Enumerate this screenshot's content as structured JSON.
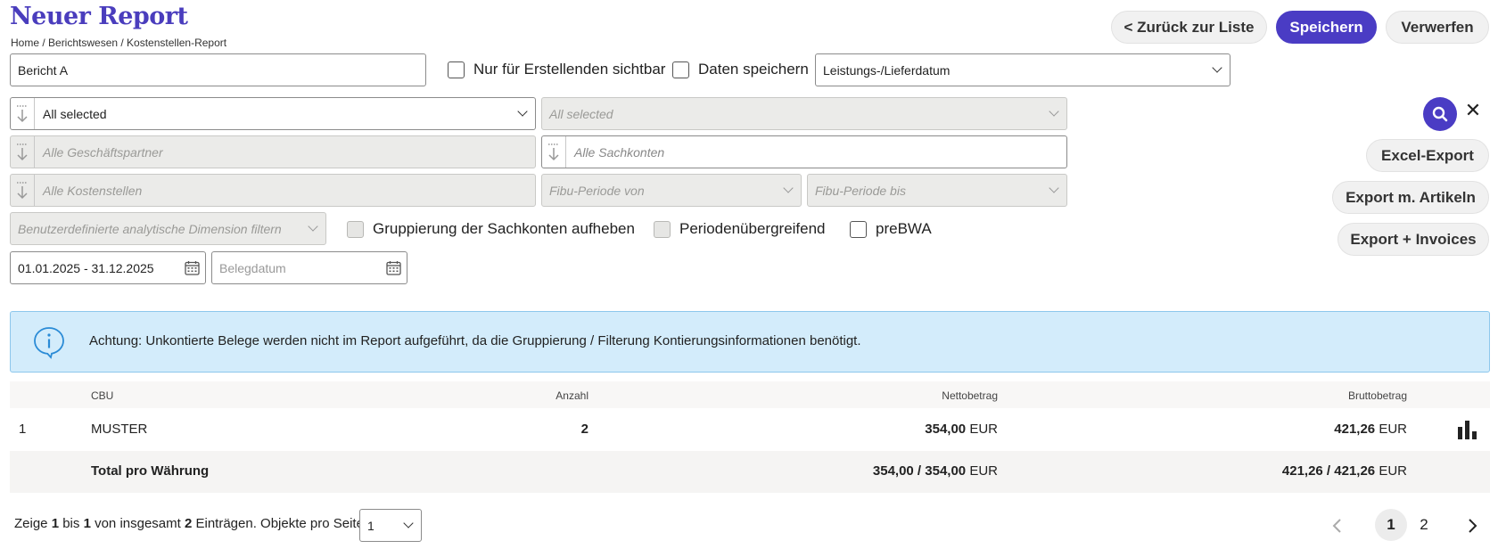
{
  "header": {
    "title": "Neuer Report",
    "breadcrumb": "Home / Berichtswesen / Kostenstellen-Report",
    "back_label": "< Zurück zur Liste",
    "save_label": "Speichern",
    "discard_label": "Verwerfen"
  },
  "form": {
    "report_name": "Bericht A",
    "only_creator_label": "Nur für Erstellenden sichtbar",
    "save_data_label": "Daten speichern",
    "date_type_value": "Leistungs-/Lieferdatum",
    "filter1_value": "All selected",
    "filter2_placeholder": "All selected",
    "partner_placeholder": "Alle Geschäftspartner",
    "accounts_placeholder": "Alle Sachkonten",
    "cost_centers_placeholder": "Alle Kostenstellen",
    "period_from_placeholder": "Fibu-Periode von",
    "period_to_placeholder": "Fibu-Periode bis",
    "custom_dimension_placeholder": "Benutzerdefinierte analytische Dimension filtern",
    "group_accounts_label": "Gruppierung der Sachkonten aufheben",
    "cross_period_label": "Periodenübergreifend",
    "prebwa_label": "preBWA",
    "date_range_value": "01.01.2025 - 31.12.2025",
    "belegdatum_placeholder": "Belegdatum"
  },
  "actions": {
    "excel_export": "Excel-Export",
    "export_articles": "Export m. Artikeln",
    "export_invoices": "Export + Invoices"
  },
  "info": {
    "text": "Achtung: Unkontierte Belege werden nicht im Report aufgeführt, da die Gruppierung / Filterung Kontierungsinformationen benötigt."
  },
  "table": {
    "columns": [
      "CBU",
      "Anzahl",
      "Nettobetrag",
      "Bruttobetrag"
    ],
    "rows": [
      {
        "index": "1",
        "cbu": "MUSTER",
        "anzahl": "2",
        "netto": "354,00",
        "brutto": "421,26",
        "currency": "EUR"
      }
    ],
    "total": {
      "label": "Total pro Währung",
      "netto": "354,00 / 354,00",
      "brutto": "421,26 / 421,26",
      "currency": "EUR"
    }
  },
  "pagination": {
    "prefix": "Zeige",
    "from": "1",
    "mid1": "bis",
    "to": "1",
    "mid2": "von insgesamt",
    "total": "2",
    "suffix": "Einträgen. Objekte pro Seite:",
    "per_page": "1",
    "pages": [
      "1",
      "2"
    ],
    "current_page": "1"
  },
  "colors": {
    "brand": "#4a3cc4",
    "info_bg": "#d3ecfb",
    "info_border": "#8dc7ec"
  },
  "icons": [
    "search-icon",
    "close-icon",
    "calendar-icon",
    "info-icon",
    "bar-chart-icon",
    "sort-icon",
    "chevron-left-icon",
    "chevron-right-icon",
    "chevron-down-icon"
  ]
}
